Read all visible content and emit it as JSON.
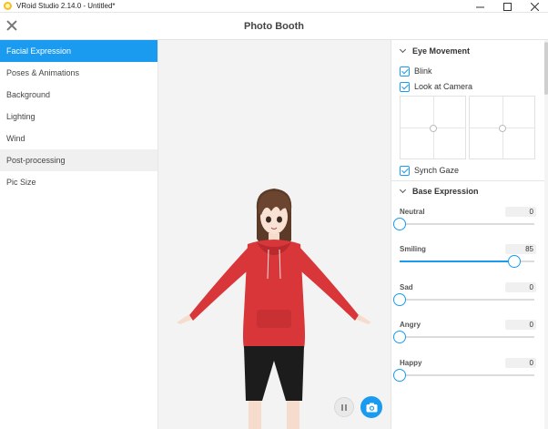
{
  "window": {
    "title": "VRoid Studio 2.14.0 - Untitled*"
  },
  "header": {
    "title": "Photo Booth"
  },
  "menu": {
    "items": [
      {
        "label": "Facial Expression",
        "state": "active"
      },
      {
        "label": "Poses & Animations",
        "state": "normal"
      },
      {
        "label": "Background",
        "state": "normal"
      },
      {
        "label": "Lighting",
        "state": "normal"
      },
      {
        "label": "Wind",
        "state": "normal"
      },
      {
        "label": "Post-processing",
        "state": "hover"
      },
      {
        "label": "Pic Size",
        "state": "normal"
      }
    ]
  },
  "eye_movement": {
    "title": "Eye Movement",
    "blink": {
      "label": "Blink",
      "checked": true
    },
    "look_at_camera": {
      "label": "Look at Camera",
      "checked": true
    },
    "synch_gaze": {
      "label": "Synch Gaze",
      "checked": true
    }
  },
  "base_expression": {
    "title": "Base Expression",
    "sliders": [
      {
        "label": "Neutral",
        "value": "0",
        "level": 0
      },
      {
        "label": "Smiling",
        "value": "85",
        "level": 85
      },
      {
        "label": "Sad",
        "value": "0",
        "level": 0
      },
      {
        "label": "Angry",
        "value": "0",
        "level": 0
      },
      {
        "label": "Happy",
        "value": "0",
        "level": 0
      }
    ]
  },
  "colors": {
    "accent": "#1a9bf0",
    "hoodie": "#d9363a",
    "hair": "#6b4530",
    "shorts": "#1c1c1c"
  }
}
